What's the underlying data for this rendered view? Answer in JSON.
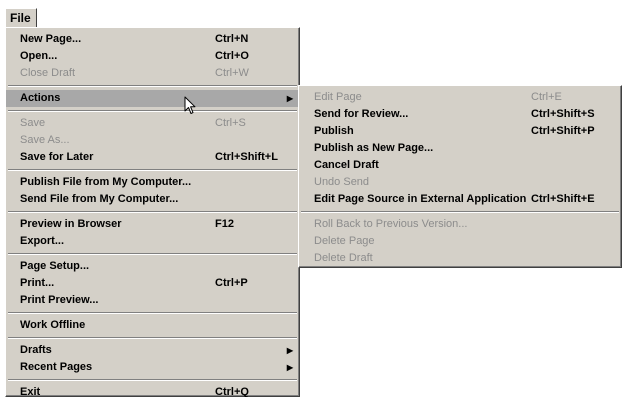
{
  "menubar": {
    "file_label": "File"
  },
  "file_menu": {
    "new_page": {
      "label": "New Page...",
      "shortcut": "Ctrl+N"
    },
    "open": {
      "label": "Open...",
      "shortcut": "Ctrl+O"
    },
    "close_draft": {
      "label": "Close Draft",
      "shortcut": "Ctrl+W"
    },
    "actions": {
      "label": "Actions"
    },
    "save": {
      "label": "Save",
      "shortcut": "Ctrl+S"
    },
    "save_as": {
      "label": "Save As..."
    },
    "save_for_later": {
      "label": "Save for Later",
      "shortcut": "Ctrl+Shift+L"
    },
    "publish_file": {
      "label": "Publish File from My Computer..."
    },
    "send_file": {
      "label": "Send File from My Computer..."
    },
    "preview_browser": {
      "label": "Preview in Browser",
      "shortcut": "F12"
    },
    "export": {
      "label": "Export..."
    },
    "page_setup": {
      "label": "Page Setup..."
    },
    "print": {
      "label": "Print...",
      "shortcut": "Ctrl+P"
    },
    "print_preview": {
      "label": "Print Preview..."
    },
    "work_offline": {
      "label": "Work Offline"
    },
    "drafts": {
      "label": "Drafts"
    },
    "recent_pages": {
      "label": "Recent Pages"
    },
    "exit": {
      "label": "Exit",
      "shortcut": "Ctrl+Q"
    }
  },
  "actions_menu": {
    "edit_page": {
      "label": "Edit Page",
      "shortcut": "Ctrl+E"
    },
    "send_for_review": {
      "label": "Send for Review...",
      "shortcut": "Ctrl+Shift+S"
    },
    "publish": {
      "label": "Publish",
      "shortcut": "Ctrl+Shift+P"
    },
    "publish_new_page": {
      "label": "Publish as New Page..."
    },
    "cancel_draft": {
      "label": "Cancel Draft"
    },
    "undo_send": {
      "label": "Undo Send"
    },
    "edit_source": {
      "label": "Edit Page Source in External Application",
      "shortcut": "Ctrl+Shift+E"
    },
    "roll_back": {
      "label": "Roll Back to Previous Version..."
    },
    "delete_page": {
      "label": "Delete Page"
    },
    "delete_draft": {
      "label": "Delete Draft"
    }
  },
  "icons": {
    "submenu_arrow": "triangle-right-icon",
    "cursor": "mouse-pointer-icon"
  }
}
